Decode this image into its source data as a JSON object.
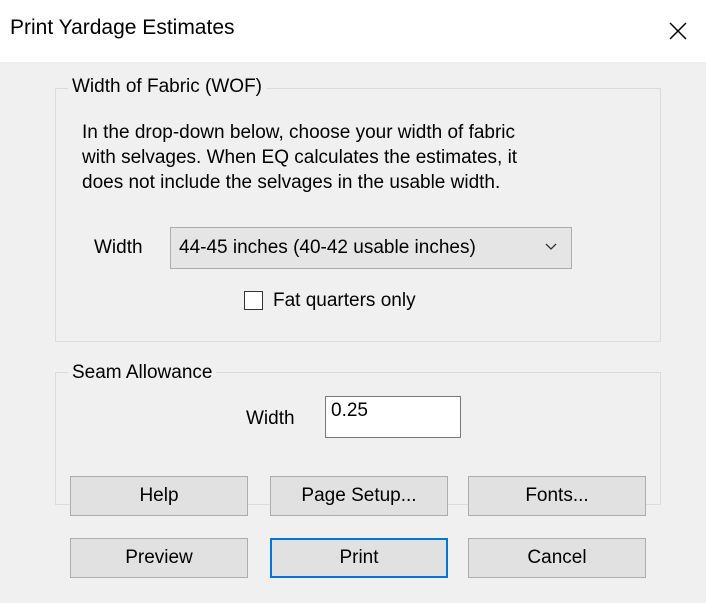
{
  "window": {
    "title": "Print Yardage Estimates"
  },
  "wof_group": {
    "legend": "Width of Fabric (WOF)",
    "description_lines": [
      "In the drop-down below, choose your width of fabric",
      "with selvages. When EQ calculates the estimates, it",
      "does not include the selvages in the usable width."
    ],
    "width_label": "Width",
    "width_selected": "44-45 inches (40-42 usable inches)",
    "fat_quarters_label": "Fat quarters only",
    "fat_quarters_checked": false
  },
  "seam_group": {
    "legend": "Seam Allowance",
    "width_label": "Width",
    "width_value": "0.25"
  },
  "buttons": {
    "help": "Help",
    "page_setup": "Page Setup...",
    "fonts": "Fonts...",
    "preview": "Preview",
    "print": "Print",
    "cancel": "Cancel"
  },
  "icons": {
    "close": "close-icon",
    "dropdown": "chevron-down-icon"
  },
  "colors": {
    "default_button_border": "#0078d7"
  }
}
